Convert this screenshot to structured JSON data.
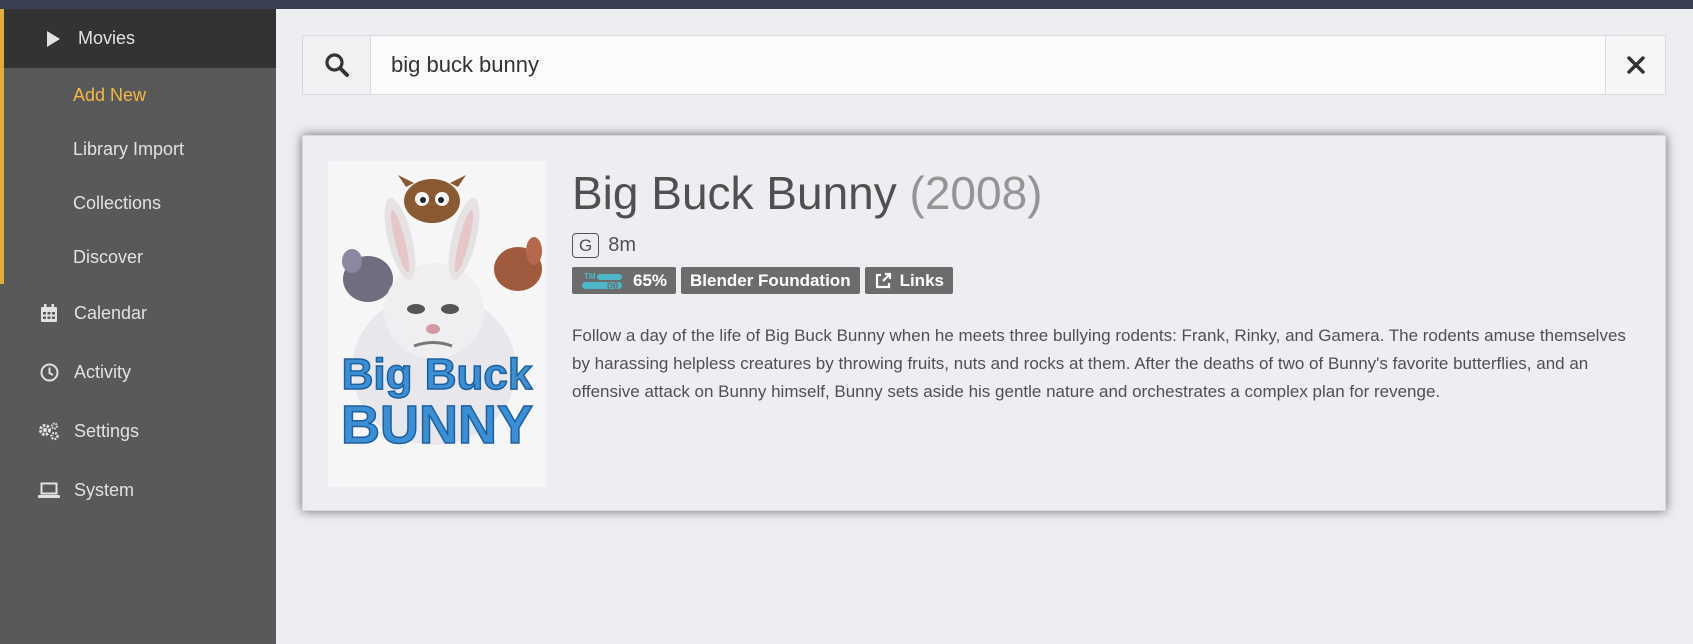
{
  "sidebar": {
    "movies": {
      "label": "Movies",
      "icon": "play-icon"
    },
    "submenu": [
      {
        "label": "Add New",
        "selected": true
      },
      {
        "label": "Library Import"
      },
      {
        "label": "Collections"
      },
      {
        "label": "Discover"
      }
    ],
    "items": [
      {
        "label": "Calendar",
        "icon": "calendar-icon"
      },
      {
        "label": "Activity",
        "icon": "clock-icon"
      },
      {
        "label": "Settings",
        "icon": "gears-icon"
      },
      {
        "label": "System",
        "icon": "laptop-icon"
      }
    ]
  },
  "search": {
    "value": "big buck bunny"
  },
  "result": {
    "title": "Big Buck Bunny",
    "year": "(2008)",
    "certification": "G",
    "runtime": "8m",
    "tmdb_logo": {
      "top": "TM",
      "bottom": "DB"
    },
    "rating": "65%",
    "studio": "Blender Foundation",
    "links": "Links",
    "poster": {
      "line1": "Big Buck",
      "line2": "BUNNY"
    },
    "overview": "Follow a day of the life of Big Buck Bunny when he meets three bullying rodents: Frank, Rinky, and Gamera. The rodents amuse themselves by harassing helpless creatures by throwing fruits, nuts and rocks at them. After the deaths of two of Bunny's favorite butterflies, and an offensive attack on Bunny himself, Bunny sets aside his gentle nature and orchestrates a complex plan for revenge."
  },
  "colors": {
    "accent": "#e0ae3e",
    "selected": "#f5b744",
    "sidebar": "#595959",
    "sidebar_active": "#333333"
  }
}
